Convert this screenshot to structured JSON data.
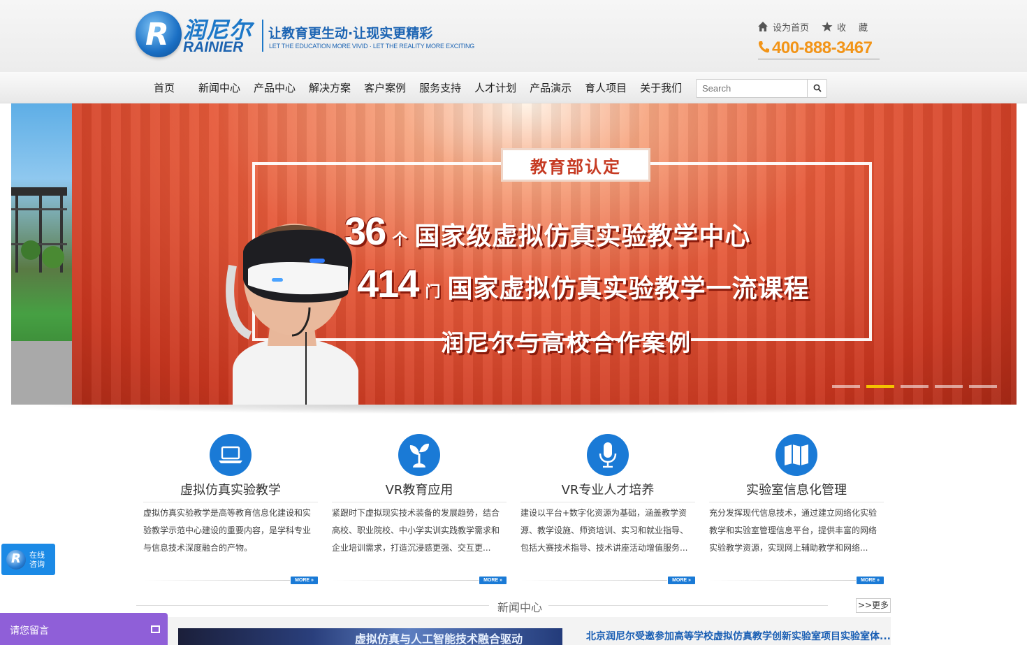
{
  "brand": {
    "name_cn": "润尼尔",
    "name_en": "RAINIER",
    "slogan_cn": "让教育更生动·让现实更精彩",
    "slogan_en": "LET THE EDUCATION MORE VIVID · LET THE REALITY MORE EXCITING"
  },
  "top_links": {
    "homepage": "设为首页",
    "favorite": "收藏",
    "phone": "400-888-3467"
  },
  "nav": {
    "items": [
      "首页",
      "新闻中心",
      "产品中心",
      "解决方案",
      "客户案例",
      "服务支持",
      "人才计划",
      "产品演示",
      "育人项目",
      "关于我们"
    ],
    "search_placeholder": "Search"
  },
  "banner": {
    "badge": "教育部认定",
    "line1_num": "36",
    "line1_unit": "个",
    "line1_text": "国家级虚拟仿真实验教学中心",
    "line2_num": "414",
    "line2_unit": "门",
    "line2_text": "国家虚拟仿真实验教学一流课程",
    "line3_text": "润尼尔与高校合作案例",
    "slides": 5,
    "active_slide": 2
  },
  "features": [
    {
      "title": "虚拟仿真实验教学",
      "desc": "虚拟仿真实验教学是高等教育信息化建设和实验教学示范中心建设的重要内容，是学科专业与信息技术深度融合的产物。",
      "icon": "laptop-icon",
      "more": "MORE"
    },
    {
      "title": "VR教育应用",
      "desc": "紧跟时下虚拟现实技术装备的发展趋势，结合高校、职业院校、中小学实训实践教学需求和企业培训需求，打造沉浸感更强、交互更...",
      "icon": "sprout-icon",
      "more": "MORE"
    },
    {
      "title": "VR专业人才培养",
      "desc": "建设以平台+数字化资源为基础，涵盖教学资源、教学设施、师资培训、实习和就业指导、包括大赛技术指导、技术讲座活动增值服务...",
      "icon": "microphone-icon",
      "more": "MORE"
    },
    {
      "title": "实验室信息化管理",
      "desc": "充分发挥现代信息技术，通过建立网络化实验教学和实验室管理信息平台，提供丰富的网络实验教学资源，实现网上辅助教学和网络...",
      "icon": "map-icon",
      "more": "MORE"
    }
  ],
  "news": {
    "title": "新闻中心",
    "more": ">>更多",
    "image_caption": "虚拟仿真与人工智能技术融合驱动",
    "headline": "北京润尼尔受邀参加高等学校虚拟仿真教学创新实验室项目实验室体..."
  },
  "widgets": {
    "consult_line1": "在线",
    "consult_line2": "咨询",
    "message": "请您留言"
  },
  "colors": {
    "brand_blue": "#1a7ad6",
    "phone_orange": "#f29417",
    "banner_red": "#e65a3a",
    "active_dot": "#f5c300",
    "message_purple": "#8f5fd8"
  }
}
